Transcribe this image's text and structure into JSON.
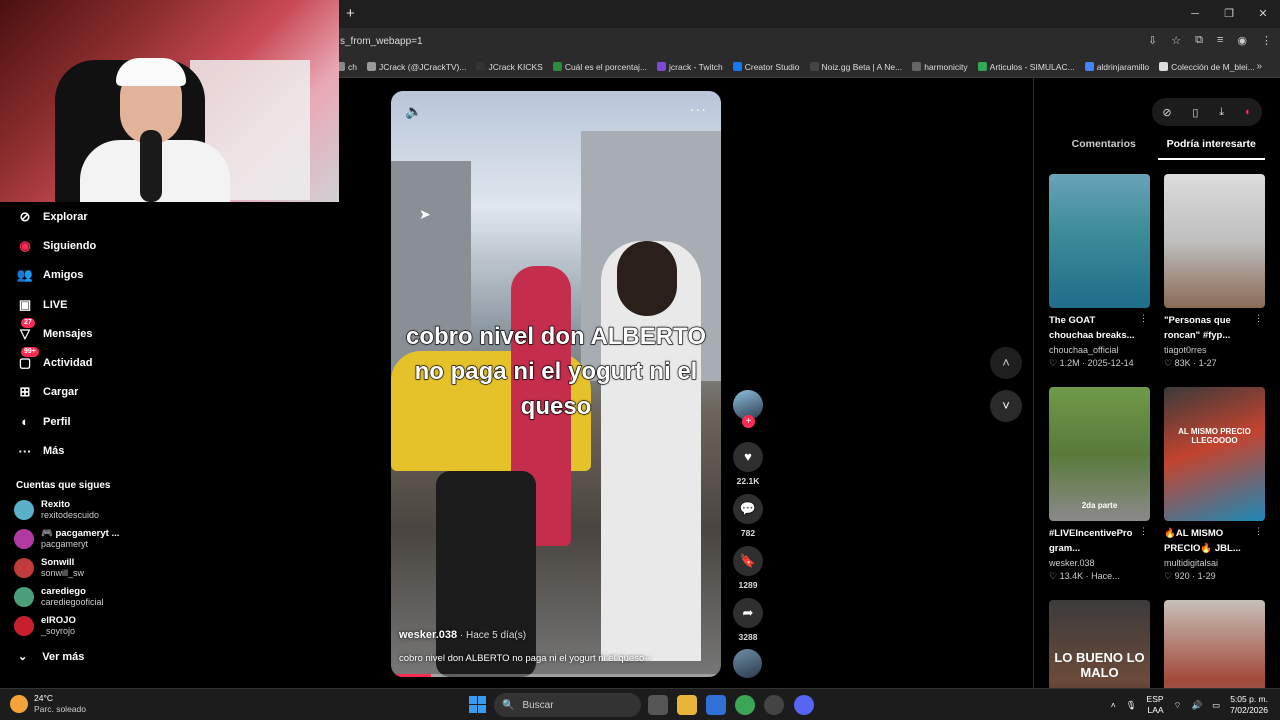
{
  "browser": {
    "url": "s_from_webapp=1",
    "bookmarks": [
      "ch",
      "JCrack (@JCrackTV)...",
      "JCrack KICKS",
      "Cuál es el porcentaj...",
      "jcrack - Twitch",
      "Creator Studio",
      "Noiz.gg Beta | A Ne...",
      "harmonicity",
      "Articulos - SIMULAC...",
      "aldrinjaramillo",
      "Colección de M_blei..."
    ],
    "bookmark_colors": [
      "#888",
      "#999",
      "#333",
      "#2d8a3e",
      "#7b4bd6",
      "#1877f2",
      "#444",
      "#666",
      "#34a853",
      "#4285f4",
      "#ddd"
    ]
  },
  "nav": {
    "items": [
      {
        "label": "Explorar",
        "icon": "compass-icon"
      },
      {
        "label": "Siguiendo",
        "icon": "following-icon"
      },
      {
        "label": "Amigos",
        "icon": "friends-icon"
      },
      {
        "label": "LIVE",
        "icon": "live-icon"
      },
      {
        "label": "Mensajes",
        "icon": "messages-icon",
        "badge": "27"
      },
      {
        "label": "Actividad",
        "icon": "activity-icon",
        "badge": "99+"
      },
      {
        "label": "Cargar",
        "icon": "upload-icon"
      },
      {
        "label": "Perfil",
        "icon": "profile-icon"
      },
      {
        "label": "Más",
        "icon": "more-icon"
      }
    ],
    "following_title": "Cuentas que sigues",
    "following": [
      {
        "name": "Rexito",
        "handle": "rexitodescuido",
        "color": "#5ab0c8"
      },
      {
        "name": "🎮 pacgameryt ...",
        "handle": "pacgameryt",
        "color": "#b03aa0"
      },
      {
        "name": "Sonwill",
        "handle": "sonwill_sw",
        "color": "#c23b3b"
      },
      {
        "name": "carediego",
        "handle": "carediegooficial",
        "color": "#4aa07a"
      },
      {
        "name": "elROJO",
        "handle": "_soyrojo",
        "color": "#c81e2e"
      }
    ],
    "see_more": "Ver más"
  },
  "video": {
    "caption": "cobro nivel don ALBERTO no paga ni el yogurt ni el queso",
    "author": "wesker.038",
    "time": " · Hace 5 día(s)",
    "description": "cobro nivel don ALBERTO no paga ni el yogurt ni el queso--",
    "progress": 0.12
  },
  "actions": {
    "likes": "22.1K",
    "comments": "782",
    "saves": "1289",
    "shares": "3288"
  },
  "panel": {
    "tabs": [
      "Comentarios",
      "Podría interesarte"
    ],
    "active_tab": "Podría interesarte",
    "cards": [
      {
        "title": "The GOAT chouchaa breaks...",
        "author": "chouchaa_official",
        "views": "1.2M",
        "date": "2025-12-14",
        "thumb_text": ""
      },
      {
        "title": "\"Personas que roncan\" #fyp...",
        "author": "tiagot0rres",
        "views": "83K",
        "date": "1-27",
        "thumb_text": ""
      },
      {
        "title": "#LIVEIncentivePro gram...",
        "author": "wesker.038",
        "views": "13.4K",
        "date": "Hace...",
        "thumb_text": "2da parte"
      },
      {
        "title": "🔥AL MISMO PRECIO🔥 JBL...",
        "author": "multidigitalsai",
        "views": "920",
        "date": "1-29",
        "thumb_text": "AL MISMO PRECIO LLEGOOOO"
      },
      {
        "title": "",
        "author": "",
        "views": "",
        "date": "",
        "thumb_text": "LO BUENO LO MALO"
      },
      {
        "title": "",
        "author": "",
        "views": "",
        "date": "",
        "thumb_text": ""
      }
    ]
  },
  "taskbar": {
    "weather_temp": "24°C",
    "weather_desc": "Parc. soleado",
    "search_placeholder": "Buscar",
    "lang": "ESP",
    "lang2": "LAA",
    "time": "5:05 p. m.",
    "date": "7/02/2026"
  }
}
